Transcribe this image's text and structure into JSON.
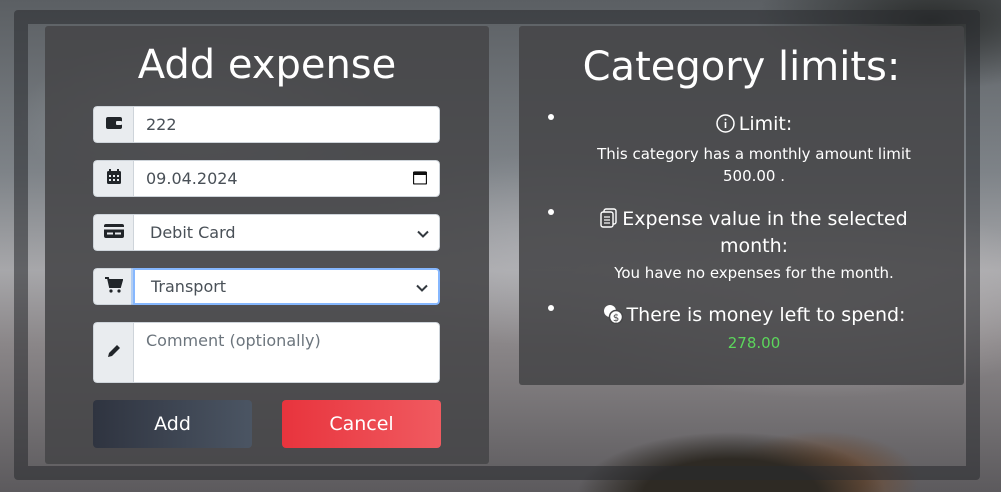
{
  "form": {
    "title": "Add expense",
    "amount_value": "222",
    "date_value": "09.04.2024",
    "payment_method_value": "Debit Card",
    "category_value": "Transport",
    "comment_placeholder": "Comment (optionally)",
    "add_label": "Add",
    "cancel_label": "Cancel"
  },
  "limits": {
    "title": "Category limits:",
    "limit_heading": "Limit:",
    "limit_text": "This category has a monthly amount limit",
    "limit_amount": "500.00 .",
    "expense_heading": "Expense value in the selected month:",
    "expense_text": "You have no expenses for the month.",
    "left_heading": "There is money left to spend:",
    "left_value": "278.00"
  },
  "colors": {
    "accent_green": "#5cd65c",
    "cancel_red": "#e8343d",
    "add_dark": "#2f3440"
  },
  "icons": [
    "wallet-icon",
    "calendar-icon",
    "credit-card-icon",
    "cart-icon",
    "pencil-icon",
    "info-icon",
    "receipts-icon",
    "coins-icon",
    "chevron-down-icon"
  ]
}
